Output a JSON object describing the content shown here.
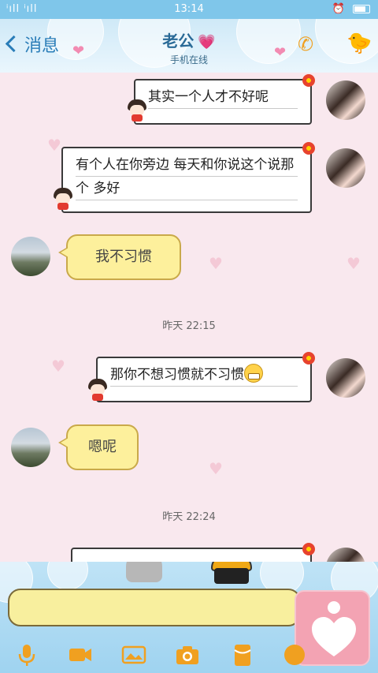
{
  "status_bar": {
    "signal_text": "ⁱıll ⁱıll",
    "time": "13:14"
  },
  "header": {
    "back_label": "消息",
    "contact_name": "老公",
    "status": "手机在线",
    "icons": [
      "chevron-left-icon",
      "phone-icon",
      "duck-icon"
    ]
  },
  "messages": [
    {
      "side": "out",
      "text": "其实一个人才不好呢"
    },
    {
      "side": "out",
      "text": "有个人在你旁边 每天和你说这个说那个 多好"
    },
    {
      "side": "in",
      "text": "我不习惯"
    },
    {
      "type": "time",
      "text": "昨天 22:15"
    },
    {
      "side": "out",
      "text": "那你不想习惯就不习惯",
      "emoji": "grin-emoji"
    },
    {
      "side": "in",
      "text": "嗯呢"
    },
    {
      "type": "time",
      "text": "昨天 22:24"
    }
  ],
  "toolbar": {
    "items": [
      "microphone-icon",
      "video-icon",
      "image-icon",
      "camera-icon",
      "red-packet-icon",
      "emoji-icon"
    ]
  },
  "colors": {
    "status_bar": "#7fc6ea",
    "bubble_in": "#fdf09c",
    "accent": "#f0a020",
    "love_button": "#f3a3b3"
  }
}
